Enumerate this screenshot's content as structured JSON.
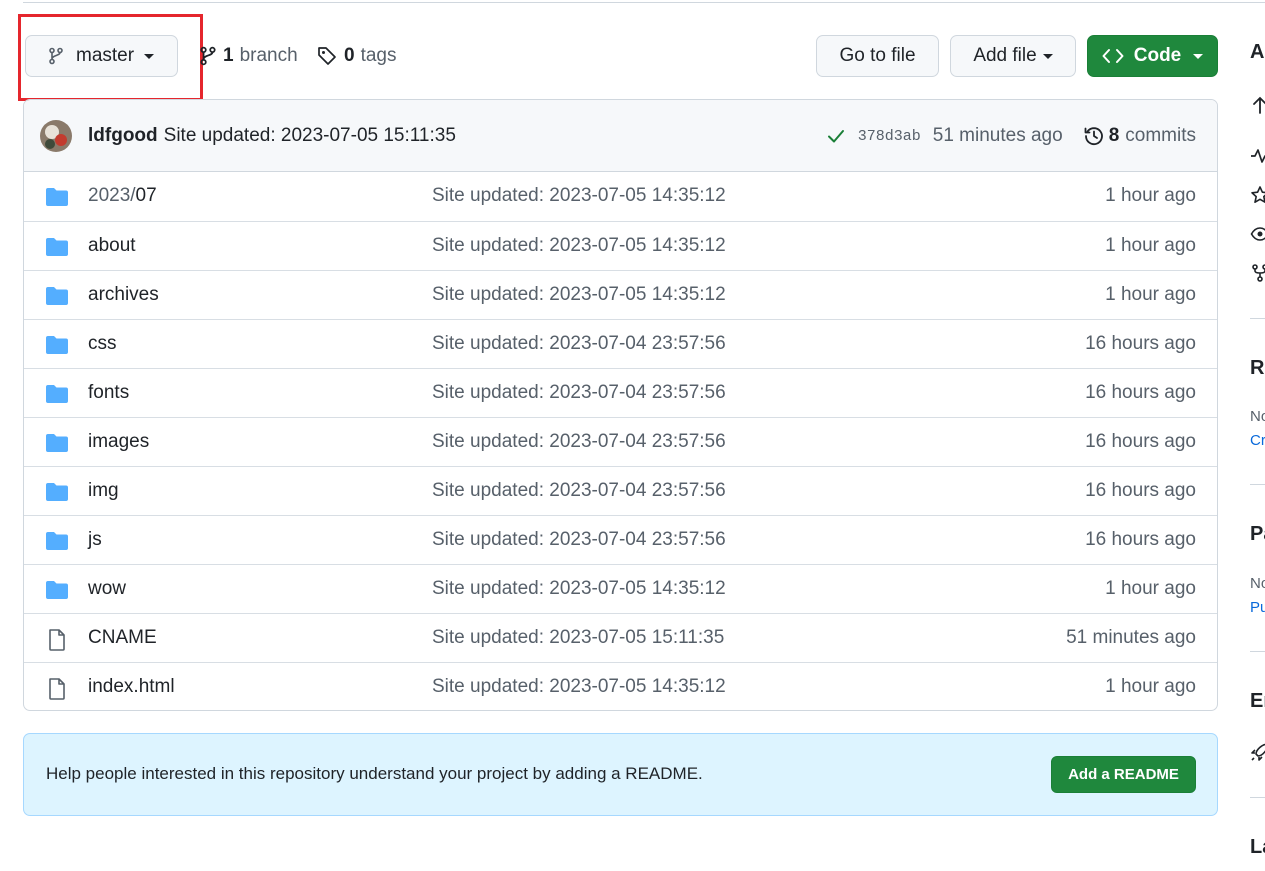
{
  "toolbar": {
    "branch_label": "master",
    "branch_count": "1",
    "branch_word": "branch",
    "tag_count": "0",
    "tag_word": "tags",
    "go_to_file": "Go to file",
    "add_file": "Add file",
    "code": "Code"
  },
  "latest_commit": {
    "author": "ldfgood",
    "message": "Site updated: 2023-07-05 15:11:35",
    "sha": "378d3ab",
    "time": "51 minutes ago",
    "commit_count": "8",
    "commit_word": "commits"
  },
  "files": [
    {
      "dir": "2023/",
      "name": "07",
      "type": "folder",
      "message": "Site updated: 2023-07-05 14:35:12",
      "time": "1 hour ago"
    },
    {
      "dir": "",
      "name": "about",
      "type": "folder",
      "message": "Site updated: 2023-07-05 14:35:12",
      "time": "1 hour ago"
    },
    {
      "dir": "",
      "name": "archives",
      "type": "folder",
      "message": "Site updated: 2023-07-05 14:35:12",
      "time": "1 hour ago"
    },
    {
      "dir": "",
      "name": "css",
      "type": "folder",
      "message": "Site updated: 2023-07-04 23:57:56",
      "time": "16 hours ago"
    },
    {
      "dir": "",
      "name": "fonts",
      "type": "folder",
      "message": "Site updated: 2023-07-04 23:57:56",
      "time": "16 hours ago"
    },
    {
      "dir": "",
      "name": "images",
      "type": "folder",
      "message": "Site updated: 2023-07-04 23:57:56",
      "time": "16 hours ago"
    },
    {
      "dir": "",
      "name": "img",
      "type": "folder",
      "message": "Site updated: 2023-07-04 23:57:56",
      "time": "16 hours ago"
    },
    {
      "dir": "",
      "name": "js",
      "type": "folder",
      "message": "Site updated: 2023-07-04 23:57:56",
      "time": "16 hours ago"
    },
    {
      "dir": "",
      "name": "wow",
      "type": "folder",
      "message": "Site updated: 2023-07-05 14:35:12",
      "time": "1 hour ago"
    },
    {
      "dir": "",
      "name": "CNAME",
      "type": "file",
      "message": "Site updated: 2023-07-05 15:11:35",
      "time": "51 minutes ago"
    },
    {
      "dir": "",
      "name": "index.html",
      "type": "file",
      "message": "Site updated: 2023-07-05 14:35:12",
      "time": "1 hour ago"
    }
  ],
  "readme_banner": {
    "text": "Help people interested in this repository understand your project by adding a README.",
    "button": "Add a README"
  },
  "sidebar": {
    "about_heading": "A",
    "releases_heading": "Re",
    "releases_note": "No",
    "releases_link": "Cr",
    "packages_heading": "Pa",
    "packages_note": "No",
    "packages_link": "Pu",
    "environments_heading": "En",
    "languages_heading": "La"
  },
  "colors": {
    "accent_green": "#1f883d",
    "folder_blue": "#54aeff",
    "highlight_red": "#e5262d",
    "banner_bg": "#ddf4ff"
  }
}
